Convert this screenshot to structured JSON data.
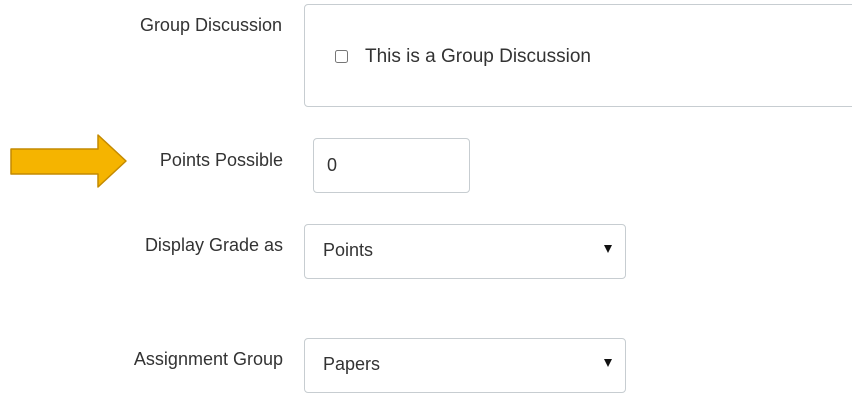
{
  "group_discussion": {
    "label": "Group Discussion",
    "checkbox_label": "This is a Group Discussion",
    "checked": false
  },
  "points_possible": {
    "label": "Points Possible",
    "value": "0",
    "highlight_arrow_icon": "arrow-right-icon",
    "arrow_color": "#f5b400"
  },
  "display_grade": {
    "label": "Display Grade as",
    "selected": "Points"
  },
  "assignment_group": {
    "label": "Assignment Group",
    "selected": "Papers"
  }
}
